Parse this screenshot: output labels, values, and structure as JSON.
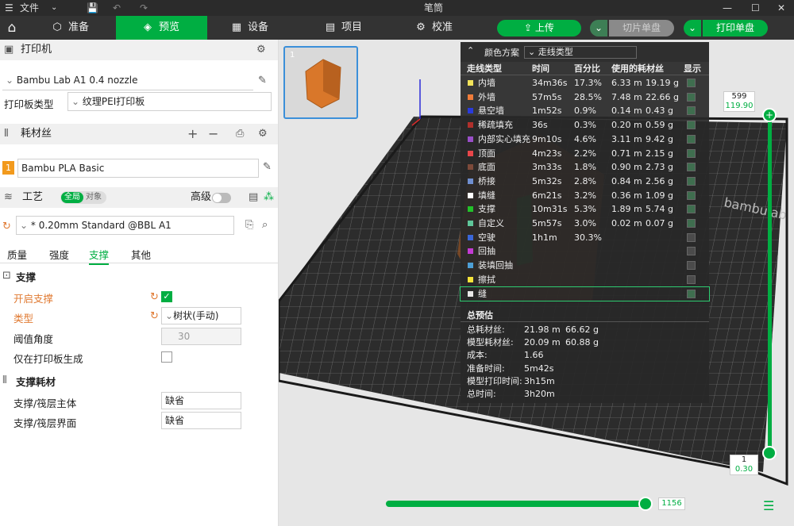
{
  "app_title": "笔筒",
  "menu": {
    "file_label": "文件"
  },
  "tabs": [
    {
      "label": "准备"
    },
    {
      "label": "预览"
    },
    {
      "label": "设备"
    },
    {
      "label": "项目"
    },
    {
      "label": "校准"
    }
  ],
  "actions": {
    "upload": "上传",
    "slice_plate": "切片单盘",
    "print_plate": "打印单盘"
  },
  "printer": {
    "section": "打印机",
    "name": "Bambu Lab A1 0.4 nozzle",
    "plate_type_label": "打印板类型",
    "plate_type": "纹理PEI打印板"
  },
  "filament": {
    "section": "耗材丝",
    "index": "1",
    "name": "Bambu PLA Basic"
  },
  "process": {
    "section": "工艺",
    "toggle_global": "全局",
    "toggle_object": "对象",
    "advanced_label": "高级",
    "profile": "* 0.20mm Standard @BBL A1",
    "subtabs": [
      "质量",
      "强度",
      "支撑",
      "其他"
    ]
  },
  "support": {
    "group_title": "支撑",
    "enable_label": "开启支撑",
    "type_label": "类型",
    "type_value": "树状(手动)",
    "threshold_label": "阈值角度",
    "threshold_value": "30",
    "plate_only_label": "仅在打印板生成",
    "filament_group_title": "支撑耗材",
    "base_label": "支撑/筏层主体",
    "base_value": "缺省",
    "interface_label": "支撑/筏层界面",
    "interface_value": "缺省"
  },
  "thumbnail": {
    "index": "1"
  },
  "overlay": {
    "scheme_label": "颜色方案",
    "scheme_value": "走线类型",
    "headers": [
      "走线类型",
      "时间",
      "百分比",
      "使用的耗材丝",
      "显示"
    ],
    "rows": [
      {
        "name": "内墙",
        "color": "#f2e35a",
        "time": "34m36s",
        "pct": "17.3%",
        "len": "6.33 m",
        "wt": "19.19 g",
        "show": true
      },
      {
        "name": "外墙",
        "color": "#f07c3a",
        "time": "57m5s",
        "pct": "28.5%",
        "len": "7.48 m",
        "wt": "22.66 g",
        "show": true
      },
      {
        "name": "悬空墙",
        "color": "#2a3bdc",
        "time": "1m52s",
        "pct": "0.9%",
        "len": "0.14 m",
        "wt": "0.43 g",
        "show": true
      },
      {
        "name": "稀疏填充",
        "color": "#b0302c",
        "time": "36s",
        "pct": "0.3%",
        "len": "0.20 m",
        "wt": "0.59 g",
        "show": true
      },
      {
        "name": "内部实心填充",
        "color": "#9a4fc8",
        "time": "9m10s",
        "pct": "4.6%",
        "len": "3.11 m",
        "wt": "9.42 g",
        "show": true
      },
      {
        "name": "顶面",
        "color": "#e8464a",
        "time": "4m23s",
        "pct": "2.2%",
        "len": "0.71 m",
        "wt": "2.15 g",
        "show": true
      },
      {
        "name": "底面",
        "color": "#7d4a3a",
        "time": "3m33s",
        "pct": "1.8%",
        "len": "0.90 m",
        "wt": "2.73 g",
        "show": true
      },
      {
        "name": "桥接",
        "color": "#6f8fd0",
        "time": "5m32s",
        "pct": "2.8%",
        "len": "0.84 m",
        "wt": "2.56 g",
        "show": true
      },
      {
        "name": "填缝",
        "color": "#ffffff",
        "time": "6m21s",
        "pct": "3.2%",
        "len": "0.36 m",
        "wt": "1.09 g",
        "show": true
      },
      {
        "name": "支撑",
        "color": "#22c12a",
        "time": "10m31s",
        "pct": "5.3%",
        "len": "1.89 m",
        "wt": "5.74 g",
        "show": true
      },
      {
        "name": "自定义",
        "color": "#5fc79a",
        "time": "5m57s",
        "pct": "3.0%",
        "len": "0.02 m",
        "wt": "0.07 g",
        "show": true
      },
      {
        "name": "空驶",
        "color": "#3a66d8",
        "time": "1h1m",
        "pct": "30.3%",
        "len": "",
        "wt": "",
        "show": false
      },
      {
        "name": "回抽",
        "color": "#c43bd4",
        "time": "",
        "pct": "",
        "len": "",
        "wt": "",
        "show": false
      },
      {
        "name": "装填回抽",
        "color": "#4d9fd6",
        "time": "",
        "pct": "",
        "len": "",
        "wt": "",
        "show": false
      },
      {
        "name": "擦拭",
        "color": "#f5e33a",
        "time": "",
        "pct": "",
        "len": "",
        "wt": "",
        "show": false
      },
      {
        "name": "缝",
        "color": "#e8e8e8",
        "time": "",
        "pct": "",
        "len": "",
        "wt": "",
        "show": true
      }
    ],
    "summary_title": "总预估",
    "summary": [
      {
        "label": "总耗材丝:",
        "v1": "21.98 m",
        "v2": "66.62 g"
      },
      {
        "label": "模型耗材丝:",
        "v1": "20.09 m",
        "v2": "60.88 g"
      },
      {
        "label": "成本:",
        "v1": "1.66",
        "v2": ""
      },
      {
        "label": "准备时间:",
        "v1": "5m42s",
        "v2": ""
      },
      {
        "label": "模型打印时间:",
        "v1": "3h15m",
        "v2": ""
      },
      {
        "label": "总时间:",
        "v1": "3h20m",
        "v2": ""
      }
    ]
  },
  "layer_slider": {
    "top_layer": "599",
    "top_height": "119.90",
    "bottom_layer": "1",
    "bottom_height": "0.30"
  },
  "move_slider": {
    "value": "1156"
  },
  "bed_brand": "bambulab",
  "colors": {
    "accent": "#00ae42",
    "model": "#d9772a"
  }
}
